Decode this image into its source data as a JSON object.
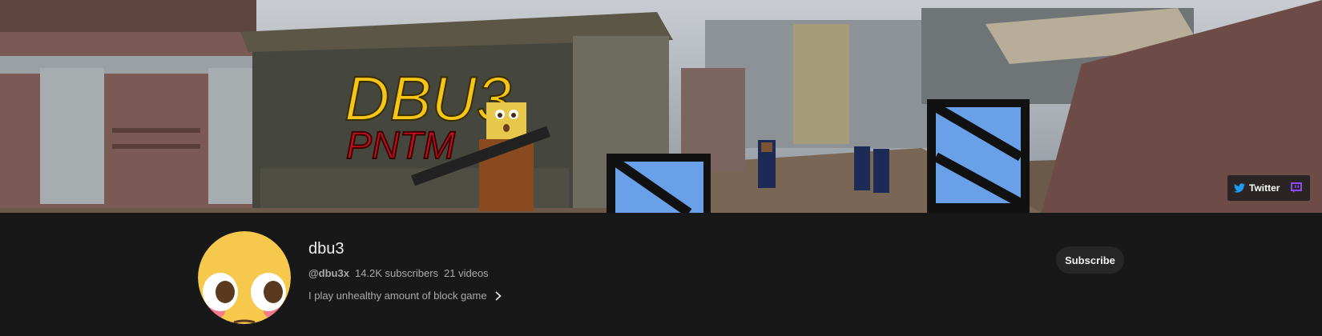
{
  "banner": {
    "logo_top": "DBU3",
    "logo_bottom": "PNTM",
    "links": {
      "twitter_label": "Twitter",
      "twitter_icon": "twitter-bird-icon",
      "twitch_icon": "twitch-icon"
    }
  },
  "channel": {
    "name": "dbu3",
    "handle": "@dbu3x",
    "subscribers": "14.2K subscribers",
    "videos": "21 videos",
    "description": "I play unhealthy amount of block game",
    "subscribe_label": "Subscribe",
    "avatar_icon": "flushed-emoji-avatar"
  },
  "colors": {
    "background": "#181818",
    "subscribe_bg": "#272727",
    "muted_text": "#aaaaaa",
    "logo_yellow": "#f5c518",
    "logo_red": "#c8101e",
    "crate_blue": "#6aa0e8",
    "twitch_purple": "#9146ff",
    "twitter_blue": "#1d9bf0"
  }
}
